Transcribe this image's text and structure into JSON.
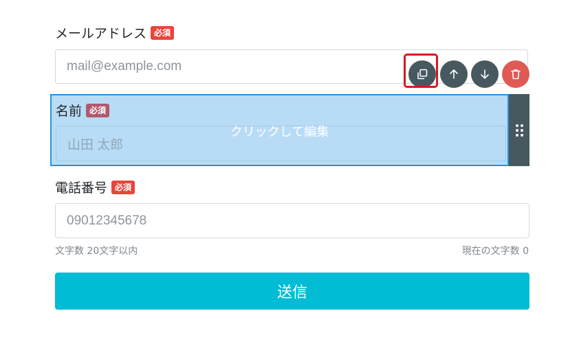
{
  "email": {
    "label": "メールアドレス",
    "required_badge": "必須",
    "placeholder": "mail@example.com"
  },
  "name": {
    "label": "名前",
    "required_badge": "必須",
    "placeholder": "山田 太郎",
    "overlay_text": "クリックして編集"
  },
  "phone": {
    "label": "電話番号",
    "required_badge": "必須",
    "placeholder": "09012345678",
    "char_limit_hint": "文字数 20文字以内",
    "char_count_hint": "現在の文字数 0"
  },
  "toolbar": {
    "icons": [
      "copy-icon",
      "arrow-up-icon",
      "arrow-down-icon",
      "trash-icon"
    ]
  },
  "colors": {
    "badge": "#e8453c",
    "selection_fill": "#b9dcf6",
    "selection_border": "#2b8fde",
    "tool_button": "#47585f",
    "delete_button": "#e05a55",
    "highlight": "#d8171f",
    "submit": "#00bcd4"
  },
  "submit_label": "送信"
}
